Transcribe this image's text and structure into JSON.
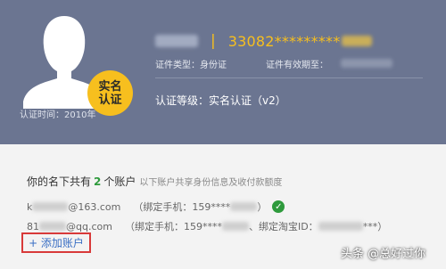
{
  "header": {
    "id_number": "33082*********",
    "cert_type_label": "证件类型：身份证",
    "validity_label": "证件有效期至：",
    "cert_level": "认证等级：实名认证（v2）",
    "badge_line1": "实名",
    "badge_line2": "认证",
    "cert_time": "认证时间：2010年",
    "separator": "|"
  },
  "accounts": {
    "summary_prefix": "你的名下共有",
    "count": "2",
    "summary_suffix": "个账户",
    "summary_note": "以下账户共享身份信息及收付款额度",
    "items": [
      {
        "email_prefix": "k",
        "email_suffix": "@163.com",
        "bind_text": "（绑定手机：159****",
        "bind_end": "）"
      },
      {
        "email_prefix": "81",
        "email_suffix": "@qq.com",
        "bind_text": "（绑定手机：159****",
        "bind_mid": "、绑定淘宝ID：",
        "bind_end": "***）"
      }
    ],
    "add_label": "+ 添加账户"
  },
  "watermark": "头条 @总好过你",
  "colors": {
    "header_bg": "#6b7591",
    "accent": "#f7bf1e",
    "green": "#2e9a3c",
    "link": "#3a6fc4",
    "highlight_border": "#d83a3a"
  }
}
